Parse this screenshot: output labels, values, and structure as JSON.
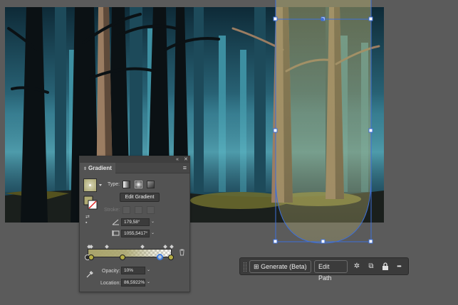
{
  "gradient_panel": {
    "title": "Gradient",
    "type_label": "Type:",
    "edit_gradient_label": "Edit Gradient",
    "stroke_label": "Stroke:",
    "angle_value": "179,58°",
    "aspect_value": "1055,5417°",
    "opacity_label": "Opacity:",
    "opacity_value": "10%",
    "location_label": "Location:",
    "location_value": "86,5922%"
  },
  "task_bar": {
    "generate_label": "Generate (Beta)",
    "edit_path_label": "Edit Path",
    "more_label": "•••"
  },
  "colors": {
    "gradient_color": "#a8a36b",
    "selection_blue": "#3e6fd8",
    "panel_bg": "#535353",
    "canvas_bg": "#5b5b5b"
  },
  "icons": [
    "gradient-swatch-icon",
    "fill-stroke-icon",
    "swap-icon",
    "linear-type-icon",
    "radial-type-icon",
    "freeform-type-icon",
    "angle-icon",
    "aspect-ratio-icon",
    "trash-icon",
    "eyedropper-icon",
    "generate-icon",
    "spinner-icon",
    "copy-icon",
    "lock-icon"
  ]
}
